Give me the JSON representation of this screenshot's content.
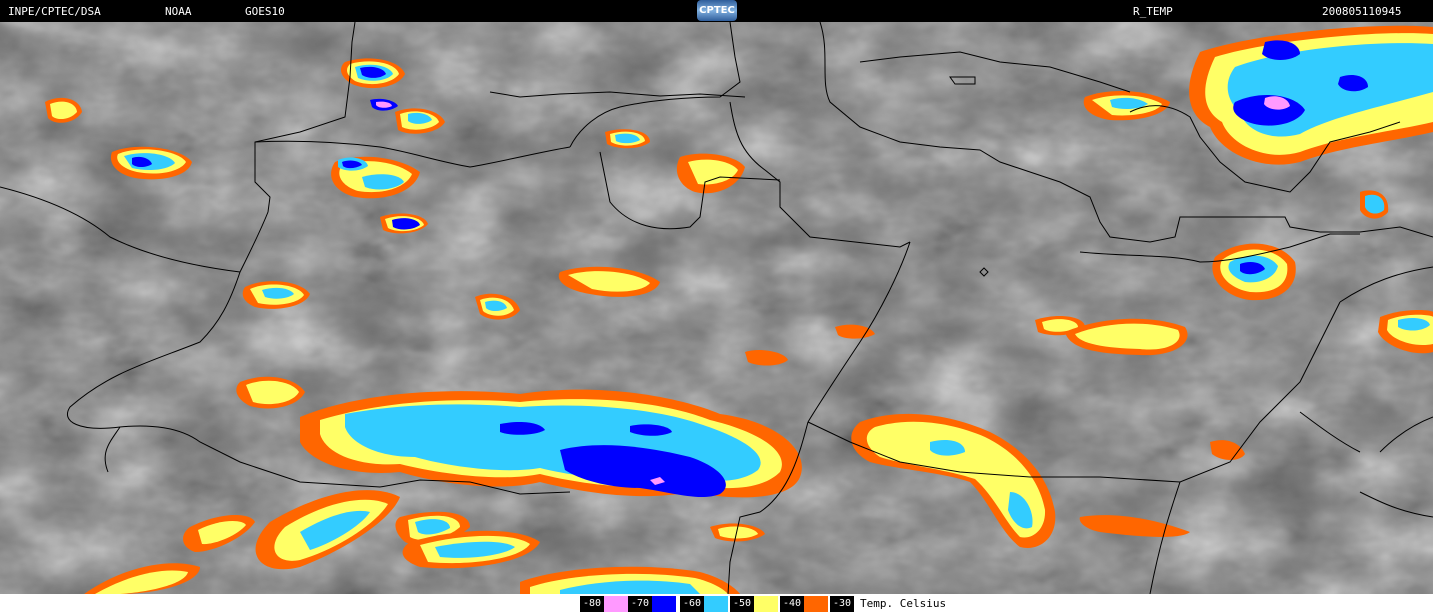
{
  "header": {
    "institution": "INPE/CPTEC/DSA",
    "agency": "NOAA",
    "satellite": "GOES10",
    "logo_text": "CPTEC",
    "product": "R_TEMP",
    "timestamp": "200805110945"
  },
  "legend": {
    "caption": "Temp. Celsius",
    "entries": [
      {
        "label": "-80",
        "color": "#ff99ff"
      },
      {
        "label": "-70",
        "color": "#0000ff"
      },
      {
        "label": "-60",
        "color": "#33ccff"
      },
      {
        "label": "-50",
        "color": "#ffff66"
      },
      {
        "label": "-40",
        "color": "#ff6600"
      },
      {
        "label": "-30",
        "color": "#ff6600"
      }
    ]
  },
  "colors": {
    "cloud_dark": "#555555",
    "cloud_mid": "#8a8a8a",
    "cloud_light": "#c8c8c8",
    "border_line": "#000000"
  }
}
